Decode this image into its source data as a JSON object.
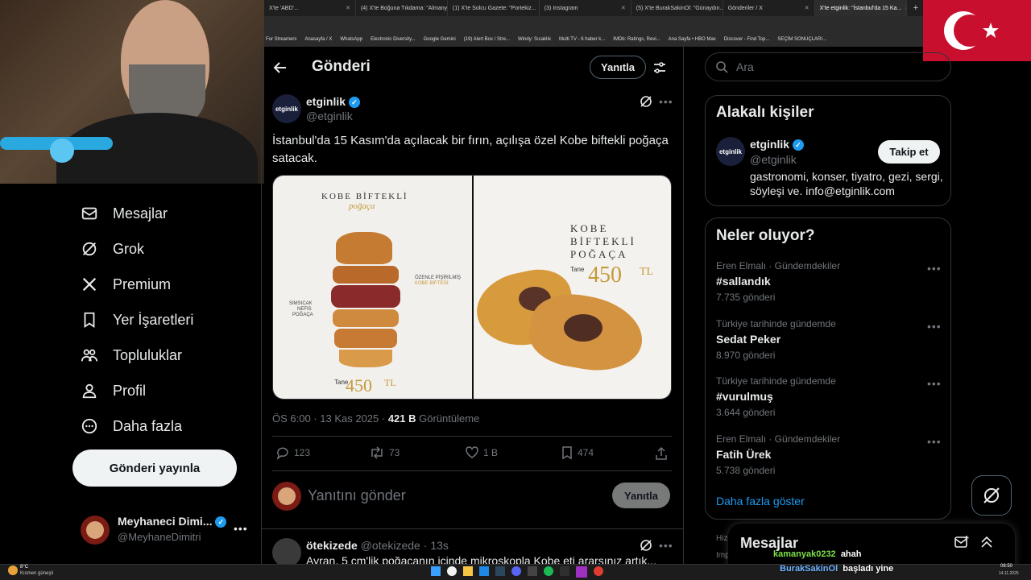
{
  "browser": {
    "tabs": [
      {
        "label": "X'te 'ABD'...",
        "active": false
      },
      {
        "label": "(4) X'te Boğuna Tıkdama: \"Almanya...",
        "active": false
      },
      {
        "label": "(1) X'te Solcu Gazete: \"Portekiz...",
        "active": false
      },
      {
        "label": "(3) Instagram",
        "active": false
      },
      {
        "label": "(5) X'te BurakSakinOl: \"Günaydın...",
        "active": false
      },
      {
        "label": "Gönderiler / X",
        "active": false
      },
      {
        "label": "X'te etginlik: \"İstanbul'da 15 Ka...",
        "active": true
      }
    ],
    "bookmarks": [
      "For Streamers",
      "Anasayfa / X",
      "WhatsApp",
      "Electronic Diversity...",
      "Google Gemini",
      "(19) Alert Box / Stre...",
      "Windy: Sıcaklık",
      "Multi TV - 6 haber k...",
      "IMDb: Ratings, Revi...",
      "Ana Sayfa • HBO Max",
      "Discover - Find Top...",
      "SEÇİM SONUÇLARI..."
    ]
  },
  "nav": {
    "items": [
      {
        "label": "Mesajlar",
        "icon": "mail-icon"
      },
      {
        "label": "Grok",
        "icon": "grok-icon"
      },
      {
        "label": "Premium",
        "icon": "x-logo-icon"
      },
      {
        "label": "Yer İşaretleri",
        "icon": "bookmark-icon"
      },
      {
        "label": "Topluluklar",
        "icon": "communities-icon"
      },
      {
        "label": "Profil",
        "icon": "profile-icon"
      },
      {
        "label": "Daha fazla",
        "icon": "more-circle-icon"
      }
    ],
    "post_button": "Gönderi yayınla",
    "account": {
      "name": "Meyhaneci Dimi...",
      "handle": "@MeyhaneDimitri"
    }
  },
  "header": {
    "title": "Gönderi",
    "reply_button": "Yanıtla"
  },
  "tweet": {
    "author_name": "etginlik",
    "author_handle": "@etginlik",
    "avatar_text": "etginlik",
    "text": "İstanbul'da 15 Kasım'da açılacak bir fırın, açılışa özel Kobe biftekli poğaça satacak.",
    "meta_time": "ÖS 6:00 · 13 Kas 2025 · ",
    "views_count": "421 B",
    "views_label": " Görüntüleme",
    "stats": {
      "replies": "123",
      "retweets": "73",
      "likes": "1 B",
      "bookmarks": "474"
    },
    "image_left": {
      "title": "KOBE BİFTEKLİ",
      "script": "poğaça",
      "label1": "ÖZENLE PİŞİRİLMİŞ",
      "label1b": "KOBE BİFTEĞİ",
      "label2": "SIMSICAK",
      "label2b": "NEFİS",
      "label2c": "POĞAÇA",
      "price_prefix": "Tane",
      "price": "450",
      "currency": "TL"
    },
    "image_right": {
      "line1": "KOBE",
      "line2": "BİFTEKLİ",
      "line3": "POĞAÇA",
      "price_prefix": "Tane",
      "price": "450",
      "currency": "TL"
    }
  },
  "reply_box": {
    "placeholder": "Yanıtını gönder",
    "button": "Yanıtla"
  },
  "reply": {
    "name": "ötekizede",
    "handle": "@otekizede",
    "time": "13s",
    "text": "Ayran, 5 cm'lik poğaçanın içinde mikroskopla Kobe eti ararsınız artık..."
  },
  "search": {
    "placeholder": "Ara"
  },
  "related": {
    "title": "Alakalı kişiler",
    "name": "etginlik",
    "handle": "@etginlik",
    "bio": "gastronomi, konser, tiyatro, gezi, sergi, söyleşi ve. info@etginlik.com",
    "follow_button": "Takip et"
  },
  "trends": {
    "title": "Neler oluyor?",
    "items": [
      {
        "context": "Eren Elmalı · Gündemdekiler",
        "name": "#sallandık",
        "count": "7.735 gönderi"
      },
      {
        "context": "Türkiye tarihinde gündemde",
        "name": "Sedat Peker",
        "count": "8.970 gönderi"
      },
      {
        "context": "Türkiye tarihinde gündemde",
        "name": "#vurulmuş",
        "count": "3.644 gönderi"
      },
      {
        "context": "Eren Elmalı · Gündemdekiler",
        "name": "Fatih Ürek",
        "count": "5.738 gönderi"
      }
    ],
    "show_more": "Daha fazla göster"
  },
  "footer_partial": {
    "line1": "Hizm",
    "line2": "Imp"
  },
  "messages_drawer": {
    "title": "Mesajlar"
  },
  "chat_overlay": [
    {
      "user": "kamanyak0232",
      "text": "ahah",
      "user_color": "#7ee04a"
    },
    {
      "user": "BurakSakinOl",
      "text": "başladı yine",
      "user_color": "#6fb3ff"
    }
  ],
  "taskbar": {
    "weather_temp": "8°C",
    "weather_desc": "Kısmen güneşli",
    "time": "08:50",
    "date": "14.11.2025"
  },
  "colors": {
    "accent": "#1d9bf0",
    "bg": "#000000",
    "border": "#2f3336",
    "muted": "#71767b"
  }
}
